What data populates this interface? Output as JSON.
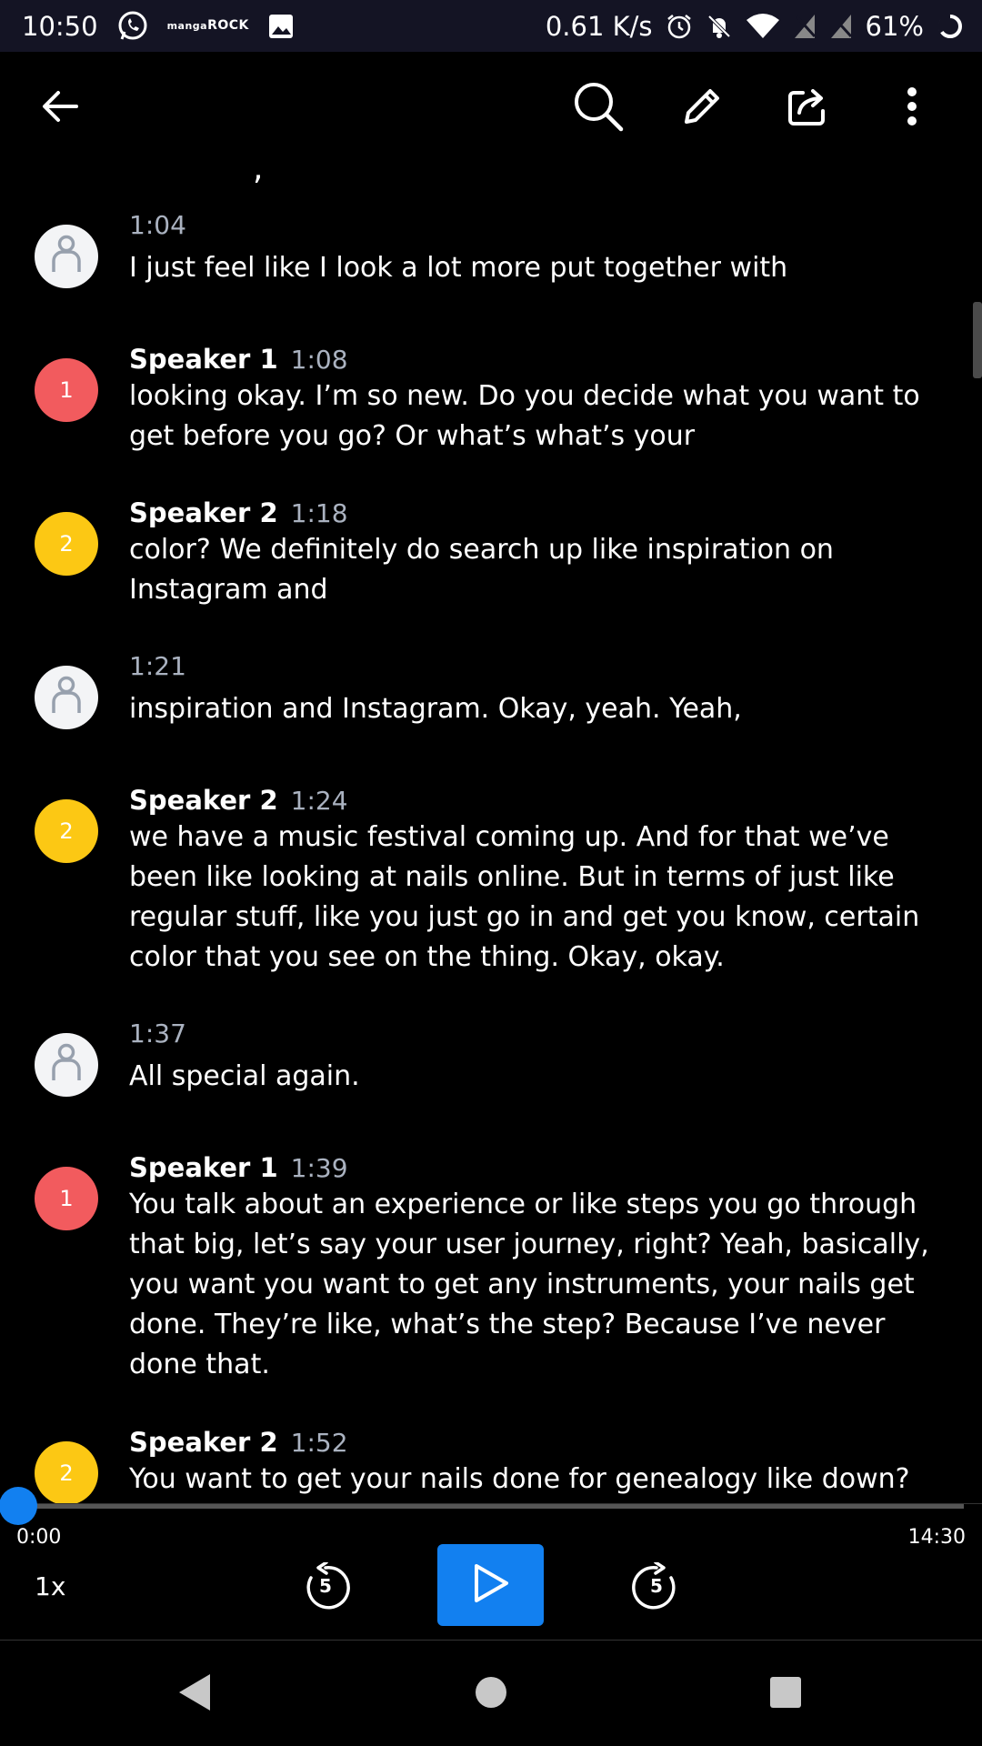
{
  "status_bar": {
    "time": "10:50",
    "manga_top": "manga",
    "manga_bottom": "ROCK",
    "net_speed": "0.61 K/s",
    "battery": "61%",
    "icons": [
      "whatsapp-icon",
      "manga-rock-icon",
      "image-icon",
      "alarm-icon",
      "bell-off-icon",
      "wifi-icon",
      "no-signal-icon",
      "no-signal-icon",
      "battery-ring-icon"
    ]
  },
  "app_bar": {
    "icons": [
      "back-arrow-icon",
      "search-icon",
      "pencil-icon",
      "share-icon",
      "more-vert-icon"
    ]
  },
  "transcript": {
    "cut_text": ",",
    "entries": [
      {
        "speaker": "",
        "avatar": "",
        "time": "1:04",
        "text": "I just feel like I look a lot more put together with"
      },
      {
        "speaker": "Speaker 1",
        "avatar": "1",
        "time": "1:08",
        "text": "looking okay. I’m so new. Do you decide what you want to get before you go? Or what’s what’s your"
      },
      {
        "speaker": "Speaker 2",
        "avatar": "2",
        "time": "1:18",
        "text": "color? We definitely do search up like inspiration on Instagram and"
      },
      {
        "speaker": "",
        "avatar": "",
        "time": "1:21",
        "text": "inspiration and Instagram. Okay, yeah. Yeah,"
      },
      {
        "speaker": "Speaker 2",
        "avatar": "2",
        "time": "1:24",
        "text": "we have a music festival coming up. And for that we’ve been like looking at nails online. But in terms of just like regular stuff, like you just go in and get you know, certain color that you see on the thing. Okay, okay."
      },
      {
        "speaker": "",
        "avatar": "",
        "time": "1:37",
        "text": "All special again."
      },
      {
        "speaker": "Speaker 1",
        "avatar": "1",
        "time": "1:39",
        "text": "You talk about an experience or like steps you go through that big, let’s say your user journey, right? Yeah, basically, you want you want to get any instruments, your nails get done. They’re like, what’s the step? Because I’ve never done that."
      },
      {
        "speaker": "Speaker 2",
        "avatar": "2",
        "time": "1:52",
        "text": "You want to get your nails done for genealogy like down?"
      }
    ]
  },
  "player": {
    "current_time": "0:00",
    "total_time": "14:30",
    "progress": 0,
    "speed": "1x",
    "rewind_seconds": "5",
    "forward_seconds": "5",
    "accent_color": "#1280f0"
  },
  "nav_bar": {
    "icons": [
      "nav-back-icon",
      "nav-home-icon",
      "nav-recents-icon"
    ]
  }
}
